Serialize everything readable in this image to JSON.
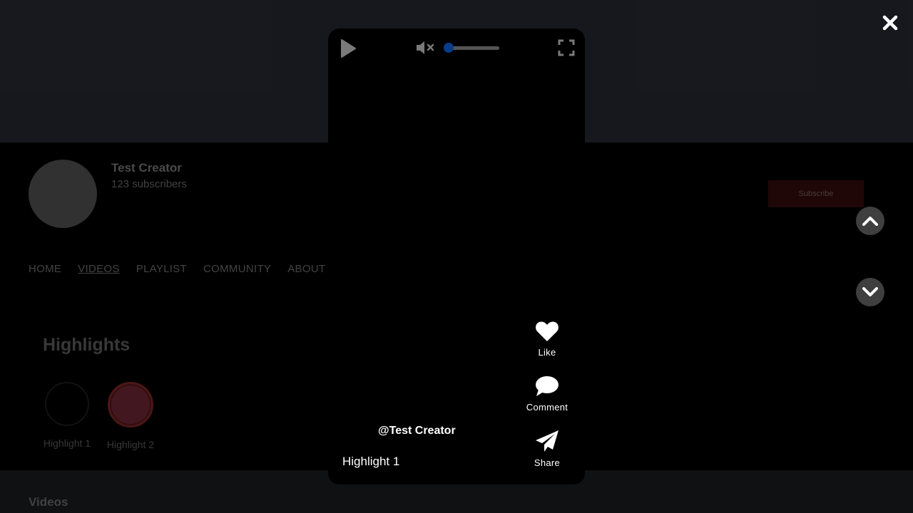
{
  "channel": {
    "name": "Test Creator",
    "subscribers": "123 subscribers",
    "subscribe_label": "Subscribe",
    "nav": [
      "HOME",
      "VIDEOS",
      "PLAYLIST",
      "COMMUNITY",
      "ABOUT"
    ],
    "active_tab": "VIDEOS",
    "highlights_title": "Highlights",
    "highlights": [
      "Highlight 1",
      "Highlight 2"
    ],
    "videos_title": "Videos"
  },
  "player": {
    "volume_level": 0,
    "muted": true,
    "actions": {
      "like": "Like",
      "comment": "Comment",
      "share": "Share"
    },
    "creator_handle": "@Test Creator",
    "caption": "Highlight 1"
  },
  "icons": {
    "close": "close-icon",
    "play": "play-icon",
    "mute": "muted-speaker-icon",
    "fullscreen": "fullscreen-icon",
    "like": "heart-icon",
    "comment": "speech-bubble-icon",
    "share": "paper-plane-icon",
    "prev": "chevron-up-icon",
    "next": "chevron-down-icon"
  },
  "colors": {
    "banner": "#2a2d36",
    "accent_volume": "#0a3b8a",
    "subscribe_bg": "#3a0d0d"
  }
}
